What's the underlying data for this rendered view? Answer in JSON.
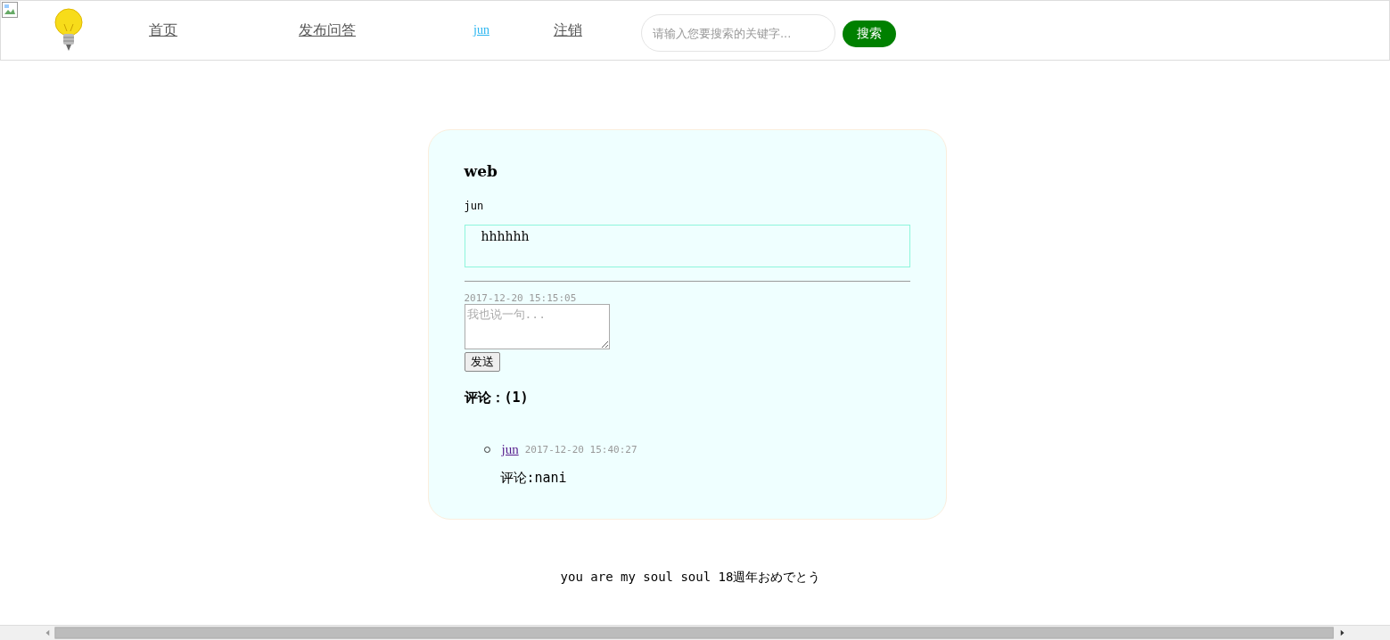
{
  "nav": {
    "links": [
      {
        "label": "首页",
        "kind": "plain"
      },
      {
        "label": "发布问答",
        "kind": "plain"
      },
      {
        "label": "jun",
        "kind": "user"
      },
      {
        "label": "注销",
        "kind": "plain"
      }
    ],
    "search": {
      "placeholder": "请输入您要搜索的关键字...",
      "button": "搜索"
    }
  },
  "question": {
    "title": "web",
    "author": "jun",
    "body": "hhhhhh",
    "time": "2017-12-20 15:15:05",
    "reply": {
      "placeholder": "我也说一句...",
      "button": "发送"
    },
    "comments_heading": "评论：(1)",
    "comments": [
      {
        "user": "jun",
        "time": "2017-12-20 15:40:27",
        "text": "评论:nani"
      }
    ]
  },
  "footer": "you are my soul soul 18週年おめでとう"
}
